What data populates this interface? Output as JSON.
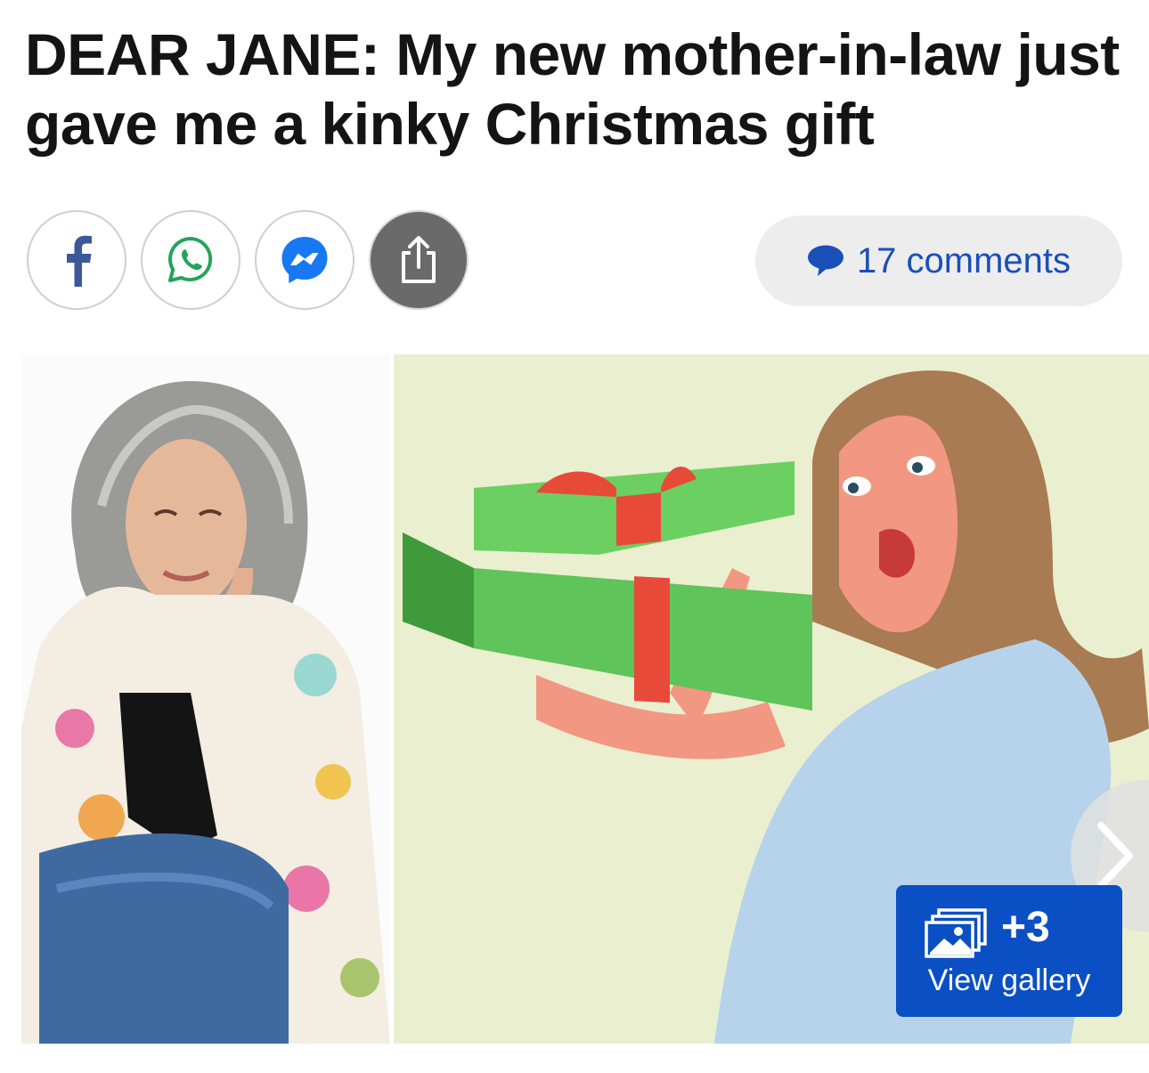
{
  "article": {
    "headline": "DEAR JANE: My new mother-in-law just gave me a kinky Christmas gift"
  },
  "share": {
    "buttons": [
      {
        "icon": "facebook-icon"
      },
      {
        "icon": "whatsapp-icon"
      },
      {
        "icon": "messenger-icon"
      },
      {
        "icon": "share-icon"
      }
    ]
  },
  "comments": {
    "label": "17 comments",
    "icon": "speech-bubble-icon",
    "color": "#1a4fb8"
  },
  "gallery": {
    "count": "+3",
    "label": "View gallery",
    "icon": "gallery-icon",
    "color": "#0b4fc4"
  },
  "colors": {
    "facebook": "#3b5998",
    "whatsapp": "#25a35a",
    "messenger": "#1877f2",
    "share_bg": "#6a6a6a",
    "illustration_bg": "#eaefcf"
  }
}
